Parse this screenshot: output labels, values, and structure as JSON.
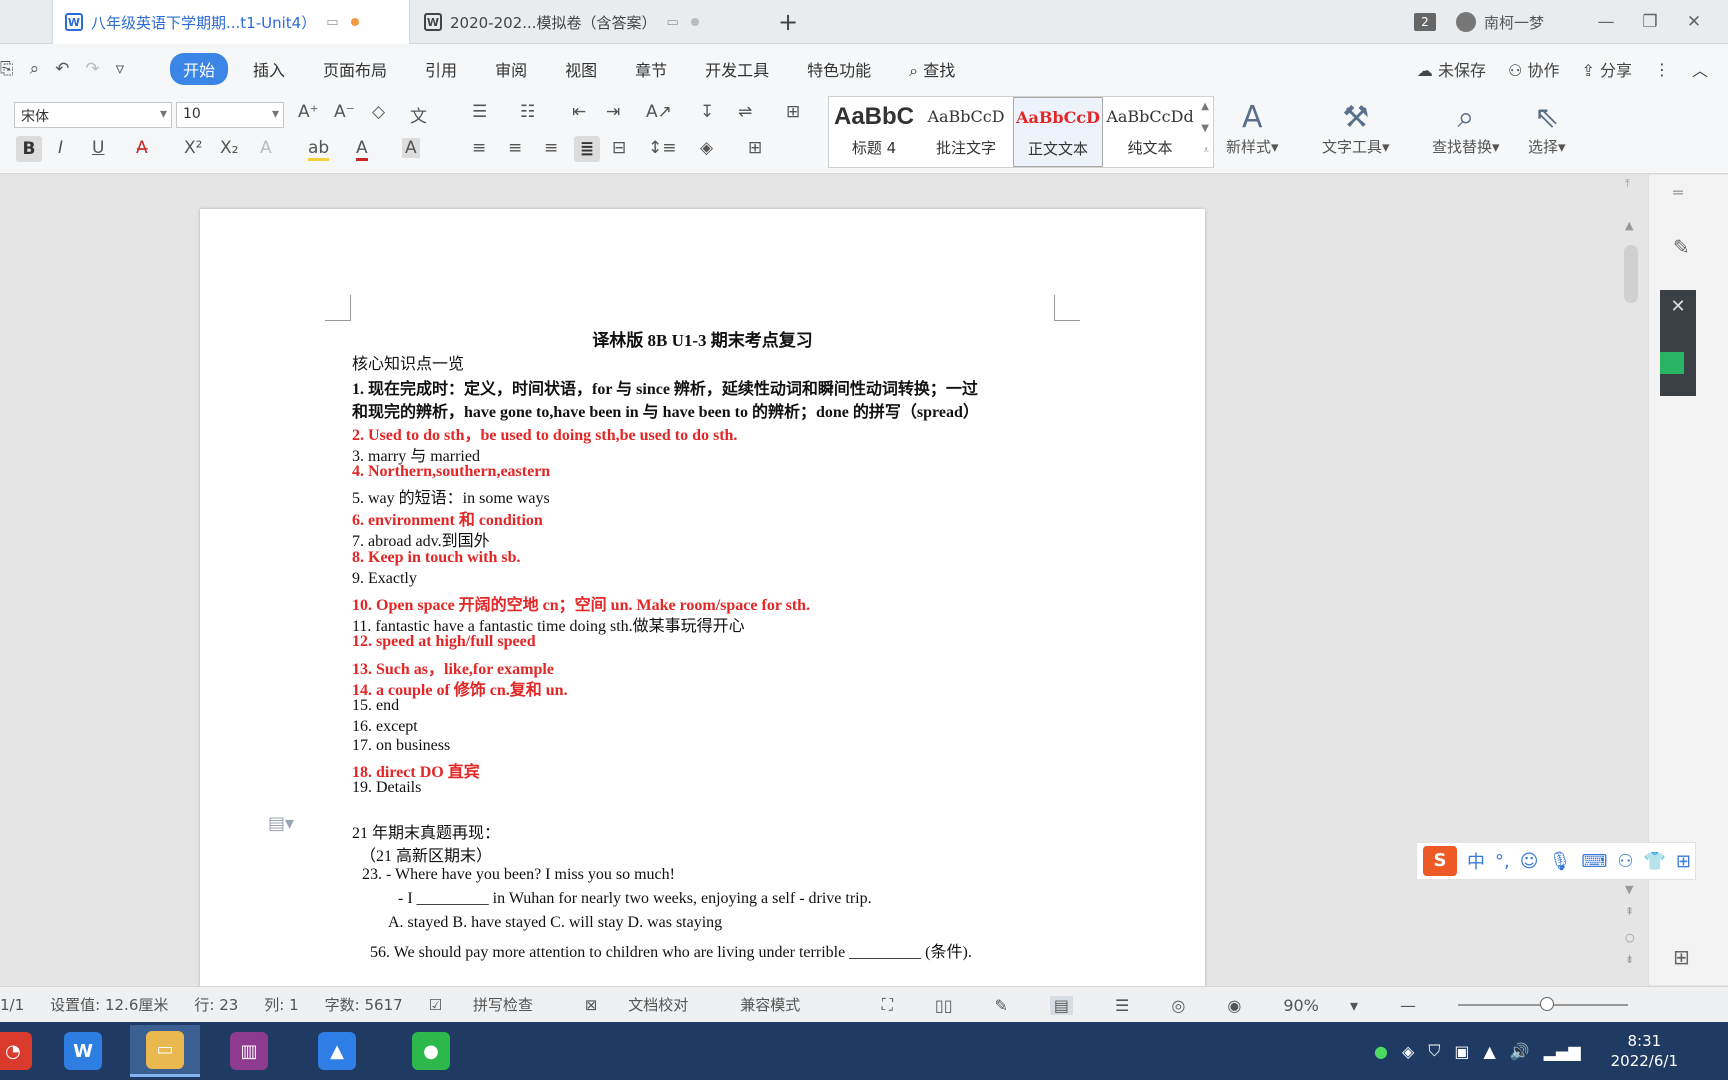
{
  "tabs": [
    {
      "title": "八年级英语下学期期...t1-Unit4）",
      "icon": "W",
      "active": true
    },
    {
      "title": "2020-202...模拟卷（含答案）",
      "icon": "W",
      "active": false
    }
  ],
  "window": {
    "badge_count": "2",
    "user_name": "南柯一梦"
  },
  "menu": {
    "items": [
      "开始",
      "插入",
      "页面布局",
      "引用",
      "审阅",
      "视图",
      "章节",
      "开发工具",
      "特色功能"
    ],
    "search": "查找",
    "right": {
      "unsaved": "未保存",
      "collab": "协作",
      "share": "分享"
    }
  },
  "ribbon": {
    "font_name": "宋体",
    "font_size": "10",
    "styles": [
      {
        "preview": "AaBbC",
        "name": "标题 4"
      },
      {
        "preview": "AaBbCcD",
        "name": "批注文字"
      },
      {
        "preview": "AaBbCcD",
        "name": "正文文本"
      },
      {
        "preview": "AaBbCcDd",
        "name": "纯文本"
      }
    ],
    "tools": {
      "new_style": "新样式",
      "text_tools": "文字工具",
      "find_replace": "查找替换",
      "select": "选择"
    }
  },
  "document": {
    "title": "译林版 8B U1-3 期末考点复习",
    "heading": "核心知识点一览",
    "item1_a": "1.  现在完成时：定义，时间状语，for 与 since 辨析，延续性动词和瞬间性动词转换；一过",
    "item1_b": "和现完的辨析，have gone to,have been in  与 have been to  的辨析；done 的拼写（spread）",
    "items": [
      "2.   Used to do sth，be used to doing sth,be used to do sth.",
      "3.   marry 与 married",
      "4.   Northern,southern,eastern",
      "5.   way 的短语：in some ways",
      "6.   environment 和 condition",
      "7.   abroad adv.到国外",
      "8.   Keep  in touch with sb.",
      "9.   Exactly",
      "10. Open space  开阔的空地  cn；空间  un. Make room/space for sth.",
      "11. fantastic have a fantastic time doing sth.做某事玩得开心",
      "12. speed at high/full speed",
      "13. Such as，like,for example",
      "14. a couple of    修饰 cn.复和 un.",
      "15. end",
      "16. except",
      "17. on business",
      "18. direct DO  直宾",
      "19. Details"
    ],
    "section_title": "21 年期末真题再现：",
    "section_sub": "（21 高新区期末）",
    "q23": "23.     - Where have you been? I miss you so much!",
    "q23_b": "- I _________ in Wuhan for nearly two weeks, enjoying a self - drive trip.",
    "q23_options": "A. stayed                B. have stayed         C. will stay                D. was staying",
    "q56": "56. We should pay more attention to children who are living under terrible _________ (条件)."
  },
  "statusbar": {
    "page": "1/1",
    "setting": "设置值: 12.6厘米",
    "row": "行: 23",
    "col": "列: 1",
    "wordcount": "字数: 5617",
    "spellcheck": "拼写检查",
    "proofread": "文档校对",
    "compat": "兼容模式",
    "zoom": "90%"
  },
  "taskbar": {
    "time": "8:31",
    "date": "2022/6/1"
  },
  "colors": {
    "accent": "#3a85e6",
    "red_text": "#e32626",
    "taskbar": "#1f3b63"
  }
}
